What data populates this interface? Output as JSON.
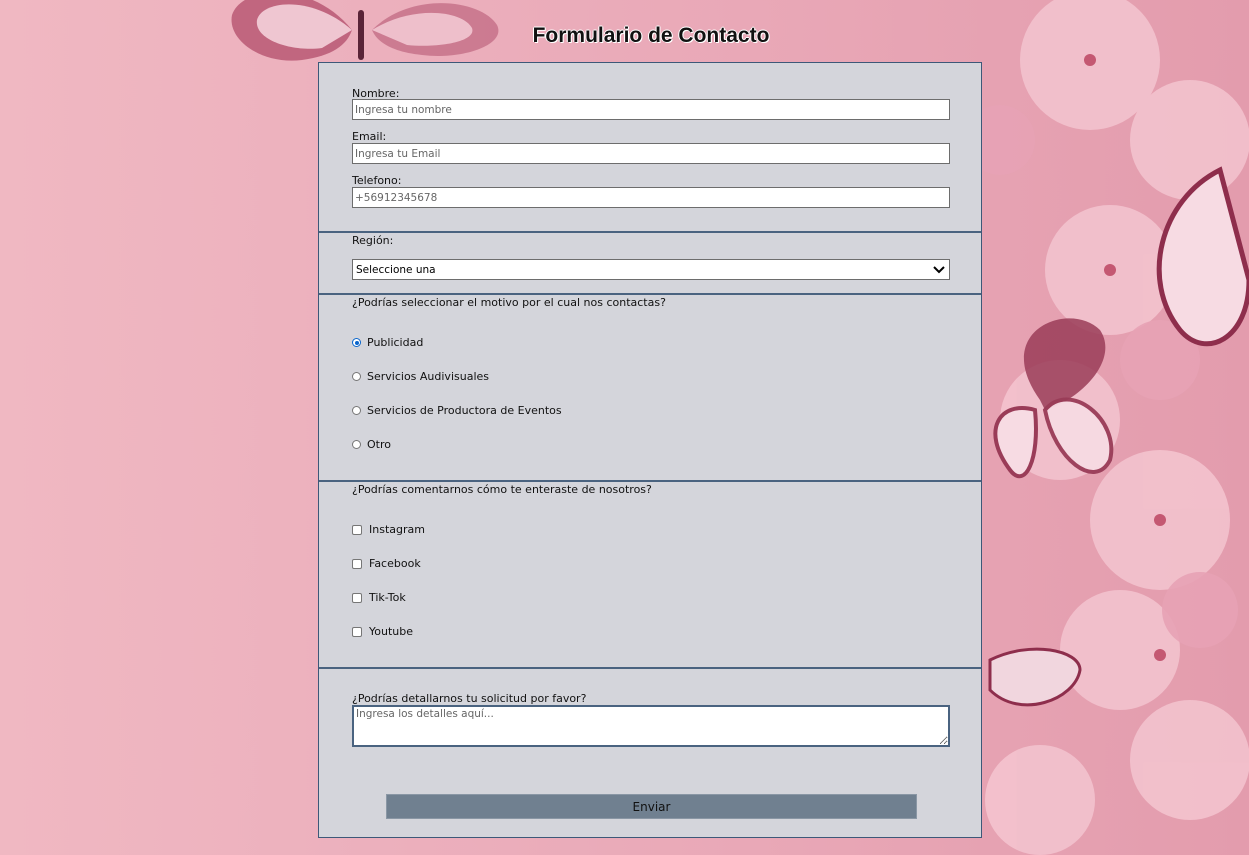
{
  "page": {
    "title": "Formulario de Contacto"
  },
  "contact": {
    "name_label": "Nombre:",
    "name_placeholder": "Ingresa tu nombre",
    "email_label": "Email:",
    "email_placeholder": "Ingresa tu Email",
    "phone_label": "Telefono:",
    "phone_placeholder": "+56912345678"
  },
  "region": {
    "label": "Región:",
    "selected": "Seleccione una"
  },
  "reason": {
    "question": "¿Podrías seleccionar el motivo por el cual nos contactas?",
    "options": [
      "Publicidad",
      "Servicios Audivisuales",
      "Servicios de Productora de Eventos",
      "Otro"
    ],
    "selected": "Publicidad"
  },
  "source": {
    "question": "¿Podrías comentarnos cómo te enteraste de nosotros?",
    "options": [
      "Instagram",
      "Facebook",
      "Tik-Tok",
      "Youtube"
    ]
  },
  "details": {
    "question": "¿Podrías detallarnos tu solicitud por favor?",
    "placeholder": "Ingresa los detalles aquí..."
  },
  "submit": {
    "label": "Enviar"
  },
  "colors": {
    "form_bg": "#d4d5db",
    "border": "#4a6380",
    "button": "#708090",
    "radio_accent": "#0a66cc",
    "background": "#eab0bd"
  },
  "icons": {
    "select_arrow": "chevron-down-icon",
    "decor": [
      "butterfly-icon",
      "flower-icon"
    ]
  }
}
